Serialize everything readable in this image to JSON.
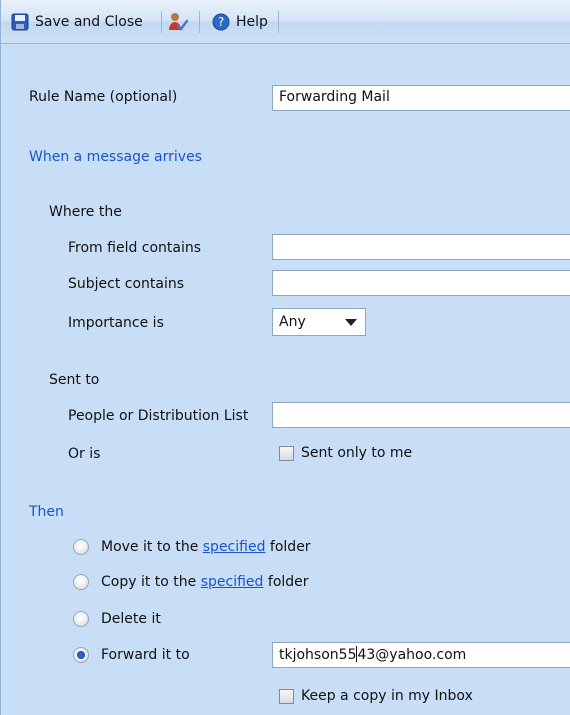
{
  "toolbar": {
    "save_close_label": "Save and Close",
    "help_label": "Help"
  },
  "rule": {
    "name_label": "Rule Name  (optional)",
    "name_value": "Forwarding Mail"
  },
  "conditions": {
    "section_title": "When a message arrives",
    "where_the_label": "Where the",
    "from_label": "From field contains",
    "from_value": "",
    "subject_label": "Subject contains",
    "subject_value": "",
    "importance_label": "Importance is",
    "importance_value": "Any",
    "sent_to_label": "Sent to",
    "people_label": "People or Distribution List",
    "people_value": "",
    "or_is_label": "Or is",
    "sent_only_label": "Sent only to me"
  },
  "actions": {
    "section_title": "Then",
    "move_prefix": "Move it to the",
    "move_link": "specified",
    "move_suffix": "folder",
    "copy_prefix": "Copy it to the",
    "copy_link": "specified",
    "copy_suffix": "folder",
    "delete_label": "Delete it",
    "forward_label": "Forward it to",
    "forward_value_before_cursor": "tkjohson55",
    "forward_value_after_cursor": "43@yahoo.com",
    "keep_copy_label": "Keep a copy in my Inbox"
  },
  "colors": {
    "page_background": "#c8def6",
    "accent": "#1b53c9"
  },
  "icons": {
    "save": "floppy-disk-icon",
    "check_names": "person-check-icon",
    "help": "help-circle-icon"
  }
}
